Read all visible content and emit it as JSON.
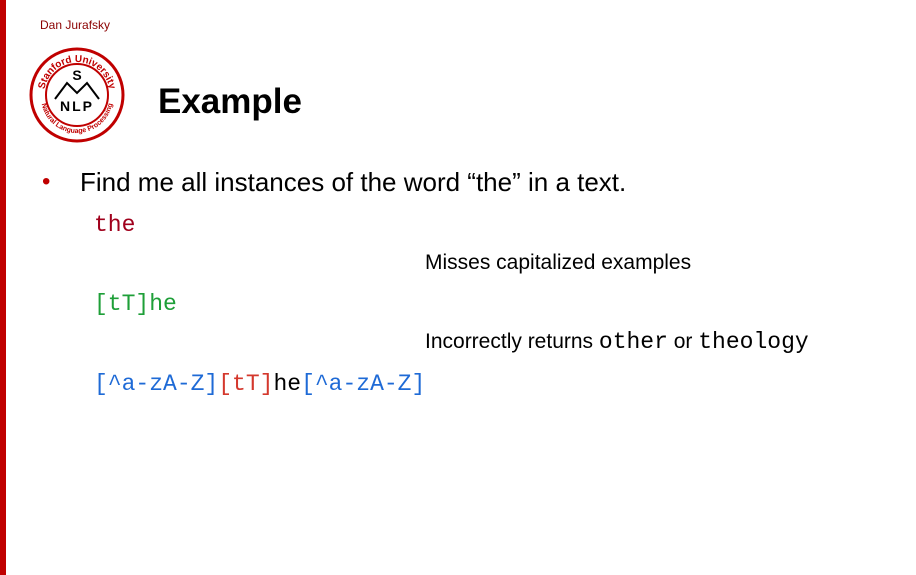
{
  "header": {
    "author": "Dan Jurafsky",
    "title": "Example"
  },
  "logo": {
    "top_text": "Stanford University",
    "bottom_text": "Natural Language Processing",
    "s_letter": "S",
    "nlp": "NLP",
    "color": "#c00000"
  },
  "bullet": {
    "marker": "•",
    "text": "Find me all instances of the word “the” in a text."
  },
  "patterns": {
    "p1": "the",
    "note1": "Misses capitalized examples",
    "p2": "[tT]he",
    "note2_prefix": "Incorrectly returns ",
    "note2_word1": "other",
    "note2_mid": " or ",
    "note2_word2": "theology",
    "p3_part1": "[^a-zA-Z]",
    "p3_part2": "[tT]",
    "p3_part3": "he",
    "p3_part4": "[^a-zA-Z]"
  },
  "colors": {
    "accent": "#c00000",
    "code_dark_red": "#a0001c",
    "code_green": "#1e9f38",
    "code_blue": "#1e6ad6",
    "code_red": "#d4382d"
  }
}
